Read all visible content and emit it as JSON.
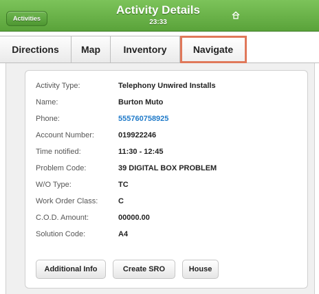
{
  "header": {
    "back_label": "Activities",
    "title": "Activity Details",
    "time": "23:33",
    "home_icon": "home-icon",
    "bg_color": "#6cb74a"
  },
  "tabs": [
    {
      "label": "Directions"
    },
    {
      "label": "Map"
    },
    {
      "label": "Inventory"
    },
    {
      "label": "Navigate",
      "highlighted": true
    }
  ],
  "details": [
    {
      "label": "Activity Type:",
      "value": "Telephony Unwired Installs"
    },
    {
      "label": "Name:",
      "value": "Burton Muto"
    },
    {
      "label": "Phone:",
      "value": "555760758925",
      "link": true
    },
    {
      "label": "Account Number:",
      "value": "019922246"
    },
    {
      "label": "Time notified:",
      "value": "11:30 - 12:45"
    },
    {
      "label": "Problem Code:",
      "value": "39 DIGITAL BOX PROBLEM"
    },
    {
      "label": "W/O Type:",
      "value": "TC"
    },
    {
      "label": "Work Order Class:",
      "value": "C"
    },
    {
      "label": "C.O.D. Amount:",
      "value": "00000.00"
    },
    {
      "label": "Solution Code:",
      "value": "A4"
    }
  ],
  "buttons": {
    "additional_info": "Additional Info",
    "create_sro": "Create SRO",
    "house": "House"
  },
  "colors": {
    "link": "#1f7ac9",
    "highlight_border": "#e0785a"
  }
}
